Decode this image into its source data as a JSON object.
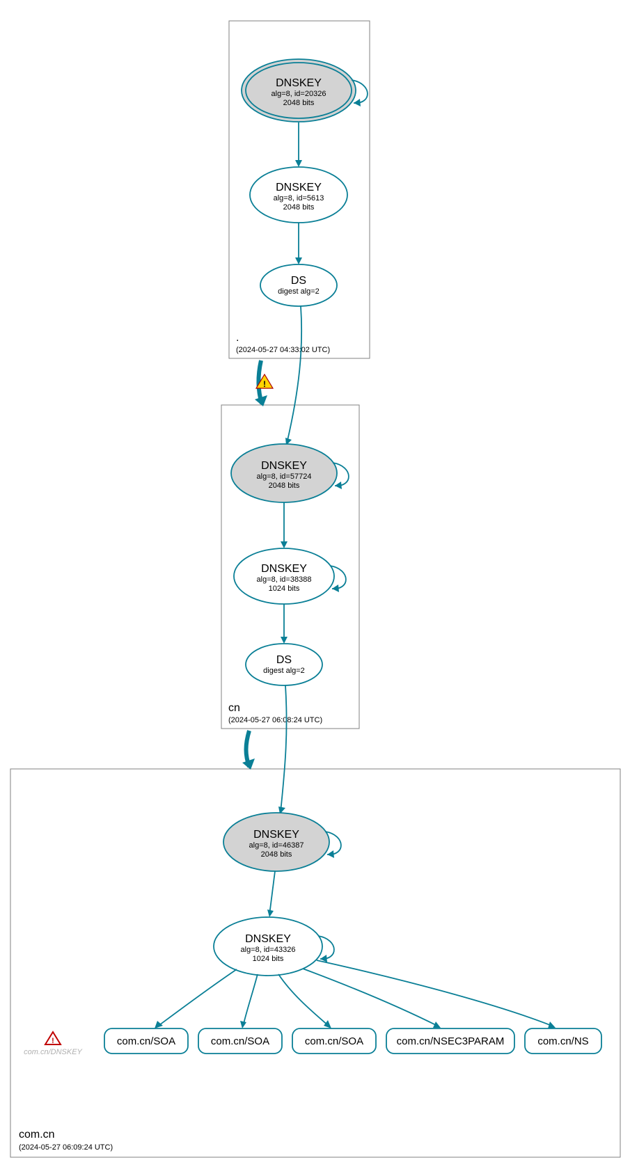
{
  "zones": {
    "root": {
      "label": ".",
      "timestamp": "(2024-05-27 04:33:02 UTC)",
      "nodes": {
        "ksk": {
          "title": "DNSKEY",
          "line1": "alg=8, id=20326",
          "line2": "2048 bits"
        },
        "zsk": {
          "title": "DNSKEY",
          "line1": "alg=8, id=5613",
          "line2": "2048 bits"
        },
        "ds": {
          "title": "DS",
          "line1": "digest alg=2"
        }
      }
    },
    "cn": {
      "label": "cn",
      "timestamp": "(2024-05-27 06:08:24 UTC)",
      "nodes": {
        "ksk": {
          "title": "DNSKEY",
          "line1": "alg=8, id=57724",
          "line2": "2048 bits"
        },
        "zsk": {
          "title": "DNSKEY",
          "line1": "alg=8, id=38388",
          "line2": "1024 bits"
        },
        "ds": {
          "title": "DS",
          "line1": "digest alg=2"
        }
      }
    },
    "comcn": {
      "label": "com.cn",
      "timestamp": "(2024-05-27 06:09:24 UTC)",
      "nodes": {
        "ksk": {
          "title": "DNSKEY",
          "line1": "alg=8, id=46387",
          "line2": "2048 bits"
        },
        "zsk": {
          "title": "DNSKEY",
          "line1": "alg=8, id=43326",
          "line2": "1024 bits"
        }
      },
      "rrsets": {
        "soa1": "com.cn/SOA",
        "soa2": "com.cn/SOA",
        "soa3": "com.cn/SOA",
        "nsec3": "com.cn/NSEC3PARAM",
        "ns": "com.cn/NS"
      },
      "faded": "com.cn/DNSKEY"
    }
  }
}
